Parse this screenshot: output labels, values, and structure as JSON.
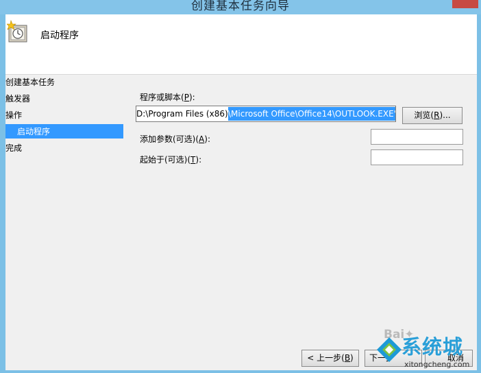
{
  "window": {
    "title": "创建基本任务向导"
  },
  "header": {
    "title": "启动程序",
    "icon": "scheduled-task-clock-icon"
  },
  "nav": {
    "items": [
      {
        "label": "创建基本任务"
      },
      {
        "label": "触发器"
      },
      {
        "label": "操作"
      },
      {
        "label": "启动程序"
      },
      {
        "label": "完成"
      }
    ]
  },
  "form": {
    "program_label_pre": "程序或脚本(",
    "program_label_key": "P",
    "program_label_post": "):",
    "program_value_plain": "D:\\Program Files (x86)",
    "program_value_selected": "\\Microsoft Office\\Office14\\OUTLOOK.EXE\"",
    "browse_pre": "浏览(",
    "browse_key": "R",
    "browse_post": ")...",
    "args_label_pre": "添加参数(可选)(",
    "args_label_key": "A",
    "args_label_post": "):",
    "args_value": "",
    "start_label_pre": "起始于(可选)(",
    "start_label_key": "T",
    "start_label_post": "):",
    "start_value": ""
  },
  "footer": {
    "back_pre": "< 上一步(",
    "back_key": "B",
    "back_post": ")",
    "next_label": "下一步",
    "cancel_label": "取消"
  },
  "watermark": {
    "text": "系统城",
    "url": "xitongcheng.com",
    "baidu": "Bai"
  },
  "colors": {
    "selection": "#3399ff",
    "titlebar": "#84c4e9",
    "close": "#c74a43"
  }
}
